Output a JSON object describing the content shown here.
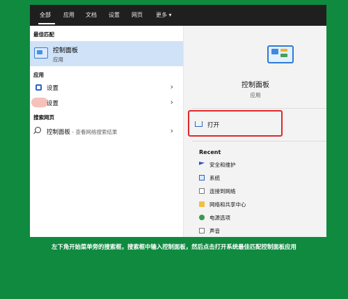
{
  "tabs": [
    "全部",
    "应用",
    "文档",
    "设置",
    "网页",
    "更多 ▾"
  ],
  "left": {
    "best_match_header": "最佳匹配",
    "best_match": {
      "title": "控制面板",
      "subtitle": "应用",
      "icon": "control-panel-icon"
    },
    "apps_header": "应用",
    "apps": [
      {
        "label": "设置",
        "icon": "gear-icon"
      },
      {
        "label": "设置",
        "icon": "gear-icon"
      }
    ],
    "web_header": "搜索网页",
    "web": {
      "label": "控制面板",
      "sub": " - 查看网络搜索结果",
      "icon": "search-icon"
    }
  },
  "right": {
    "title": "控制面板",
    "subtitle": "应用",
    "open_label": "打开",
    "recent_header": "Recent",
    "recent": [
      {
        "label": "安全和维护",
        "icon": "flag-icon"
      },
      {
        "label": "系统",
        "icon": "monitor-icon"
      },
      {
        "label": "连接到网络",
        "icon": "document-icon"
      },
      {
        "label": "网络和共享中心",
        "icon": "folder-icon"
      },
      {
        "label": "电源选项",
        "icon": "power-icon"
      },
      {
        "label": "声音",
        "icon": "document-icon"
      }
    ]
  },
  "caption": "左下角开始菜单旁的搜索框，搜索框中输入控制面板，然后点击打开系统最佳匹配控制面板应用",
  "colors": {
    "background": "#0f8a3f",
    "highlight": "#e0272a",
    "selection": "#cfe2f7",
    "topbar": "#1f1f1f"
  }
}
